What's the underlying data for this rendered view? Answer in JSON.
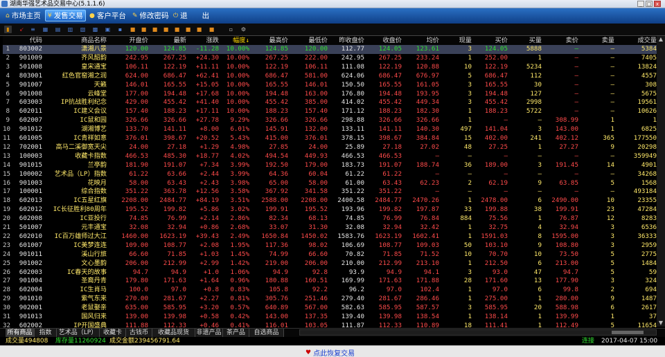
{
  "window": {
    "title": "湖南华强艺术品交易中心(5.1.1.6)"
  },
  "menu": [
    {
      "label": "市场主页",
      "icon": "house-icon",
      "active": false
    },
    {
      "label": "发售交易",
      "icon": "yen-icon",
      "active": true
    },
    {
      "label": "客户平台",
      "icon": "person-icon",
      "active": false
    },
    {
      "label": "修改密码",
      "icon": "key-icon",
      "active": false
    },
    {
      "label": "退　　出",
      "icon": "exit-icon",
      "active": false
    }
  ],
  "toolbar_icons": [
    "quote-board-icon",
    "k-line-icon",
    "list-icon",
    "table-icon",
    "calc-icon",
    "chart-icon",
    "chart2-icon",
    "grid-icon",
    "report-icon",
    "report2-icon",
    "print-icon",
    "doc-icon",
    "doc2-icon",
    "doc3-icon",
    "doc4-icon",
    "doc5-icon",
    "export-icon",
    "refresh-icon",
    "settings-icon",
    "gear-icon"
  ],
  "table": {
    "columns": [
      "",
      "代码",
      "商品名称",
      "开盘价",
      "最新",
      "涨跌",
      "幅度↓",
      "最高价",
      "最低价",
      "昨收盘价",
      "收盘价",
      "均价",
      "现量",
      "买价",
      "买量",
      "卖价",
      "卖量",
      "成交量"
    ],
    "rows": [
      [
        "1",
        "803002",
        "潇湘八景",
        "120.00",
        "124.85",
        "-11.28",
        "10.00%",
        "124.85",
        "120.00",
        "112.77",
        "124.05",
        "123.61",
        "3",
        "124.05",
        "5888",
        "—",
        "—",
        "5384"
      ],
      [
        "2",
        "901009",
        "齐风韶韵",
        "242.95",
        "267.25",
        "+24.30",
        "10.00%",
        "267.25",
        "222.00",
        "242.95",
        "267.25",
        "233.24",
        "1",
        "252.00",
        "1",
        "—",
        "—",
        "7405"
      ],
      [
        "3",
        "501008",
        "皇宋通宝",
        "106.11",
        "122.19",
        "+11.11",
        "10.00%",
        "122.19",
        "106.11",
        "111.08",
        "122.19",
        "120.88",
        "10",
        "122.19",
        "5234",
        "—",
        "—",
        "13824"
      ],
      [
        "4",
        "803001",
        "红色官窑湘之润",
        "624.00",
        "686.47",
        "+62.41",
        "10.00%",
        "686.47",
        "581.00",
        "624.06",
        "686.47",
        "676.97",
        "5",
        "686.47",
        "112",
        "—",
        "—",
        "4557"
      ],
      [
        "5",
        "901007",
        "天籁",
        "146.01",
        "165.55",
        "+15.05",
        "10.00%",
        "165.55",
        "146.01",
        "150.50",
        "165.55",
        "161.05",
        "3",
        "165.55",
        "30",
        "—",
        "—",
        "308"
      ],
      [
        "6",
        "901008",
        "云峰堂",
        "177.00",
        "194.48",
        "+17.68",
        "10.00%",
        "194.48",
        "163.00",
        "176.80",
        "194.48",
        "193.95",
        "3",
        "194.48",
        "127",
        "—",
        "—",
        "5675"
      ],
      [
        "7",
        "603003",
        "IP抗战胜利纪念",
        "429.00",
        "455.42",
        "+41.40",
        "10.00%",
        "455.42",
        "385.00",
        "414.02",
        "455.42",
        "449.34",
        "3",
        "455.42",
        "2998",
        "—",
        "—",
        "19561"
      ],
      [
        "8",
        "602011",
        "IC建义会议",
        "157.40",
        "188.23",
        "+17.11",
        "10.00%",
        "188.23",
        "157.40",
        "171.12",
        "188.23",
        "182.30",
        "1",
        "188.23",
        "5722",
        "—",
        "—",
        "10626"
      ],
      [
        "9",
        "602007",
        "IC鼠和园",
        "326.66",
        "326.66",
        "+27.78",
        "9.29%",
        "326.66",
        "326.66",
        "298.88",
        "326.66",
        "326.66",
        "1",
        "—",
        "—",
        "308.99",
        "1",
        "1"
      ],
      [
        "10",
        "901012",
        "湖湘博艺",
        "133.70",
        "141.11",
        "+8.00",
        "6.01%",
        "145.91",
        "132.00",
        "133.11",
        "141.11",
        "140.30",
        "497",
        "141.04",
        "3",
        "143.00",
        "1",
        "6825"
      ],
      [
        "11",
        "601005",
        "IC青祥如意",
        "376.01",
        "398.67",
        "+20.52",
        "5.43%",
        "415.00",
        "376.01",
        "378.15",
        "398.67",
        "384.84",
        "15",
        "402.00",
        "241",
        "402.12",
        "365",
        "177550"
      ],
      [
        "12",
        "702001",
        "高马二溪御宽天尖",
        "24.00",
        "27.18",
        "+1.29",
        "4.98%",
        "27.85",
        "24.00",
        "25.89",
        "27.18",
        "27.02",
        "48",
        "27.25",
        "1",
        "27.27",
        "9",
        "20298"
      ],
      [
        "13",
        "100003",
        "收藏卡指数",
        "466.53",
        "485.30",
        "+18.77",
        "4.02%",
        "494.54",
        "449.93",
        "466.53",
        "466.53",
        "—",
        "—",
        "—",
        "—",
        "—",
        "—",
        "359949"
      ],
      [
        "14",
        "901015",
        "兰亭韵",
        "181.90",
        "191.07",
        "+7.34",
        "3.99%",
        "192.50",
        "179.00",
        "183.73",
        "191.07",
        "188.74",
        "36",
        "189.00",
        "3",
        "191.45",
        "14",
        "4901"
      ],
      [
        "15",
        "100002",
        "艺术品（LP）指数",
        "61.22",
        "63.66",
        "+2.44",
        "3.99%",
        "64.36",
        "60.04",
        "61.22",
        "61.22",
        "—",
        "—",
        "—",
        "—",
        "—",
        "—",
        "34268"
      ],
      [
        "16",
        "901003",
        "花映月",
        "58.00",
        "63.43",
        "+2.43",
        "3.98%",
        "65.00",
        "58.00",
        "61.00",
        "63.43",
        "62.23",
        "2",
        "62.19",
        "9",
        "63.85",
        "5",
        "1568"
      ],
      [
        "17",
        "100001",
        "综合指数",
        "351.22",
        "363.78",
        "+12.56",
        "3.58%",
        "367.92",
        "341.58",
        "351.22",
        "351.22",
        "—",
        "—",
        "—",
        "—",
        "—",
        "—",
        "493184"
      ],
      [
        "18",
        "602013",
        "IC五星红旗",
        "2208.00",
        "2484.77",
        "+84.19",
        "3.51%",
        "2588.00",
        "2208.00",
        "2400.58",
        "2484.77",
        "2470.26",
        "1",
        "2478.00",
        "6",
        "2490.00",
        "10",
        "23355"
      ],
      [
        "19",
        "602012",
        "IC长征胜利80周年",
        "195.52",
        "199.82",
        "+5.86",
        "3.02%",
        "199.91",
        "195.52",
        "193.96",
        "199.82",
        "197.87",
        "33",
        "199.88",
        "38",
        "199.91",
        "23",
        "47284"
      ],
      [
        "20",
        "602008",
        "IC亚投行",
        "74.85",
        "76.99",
        "+2.14",
        "2.86%",
        "82.34",
        "68.13",
        "74.85",
        "76.99",
        "76.84",
        "884",
        "75.56",
        "1",
        "76.87",
        "12",
        "8283"
      ],
      [
        "21",
        "501007",
        "元丰通宝",
        "32.08",
        "32.94",
        "+0.86",
        "2.68%",
        "33.07",
        "31.30",
        "32.08",
        "32.94",
        "32.42",
        "1",
        "32.75",
        "4",
        "32.94",
        "3",
        "6536"
      ],
      [
        "22",
        "602010",
        "IC百万雄师过大江",
        "1460.00",
        "1623.19",
        "+39.43",
        "2.49%",
        "1650.84",
        "1450.02",
        "1583.76",
        "1623.19",
        "1602.41",
        "1",
        "1591.03",
        "8",
        "1595.00",
        "3",
        "36333"
      ],
      [
        "23",
        "601007",
        "IC美梦连连",
        "109.00",
        "108.77",
        "+2.08",
        "1.95%",
        "117.36",
        "98.02",
        "106.69",
        "108.77",
        "109.03",
        "50",
        "103.10",
        "9",
        "108.80",
        "3",
        "2959"
      ],
      [
        "24",
        "901011",
        "溪山行旅",
        "66.60",
        "71.85",
        "+1.03",
        "1.45%",
        "74.99",
        "66.60",
        "70.82",
        "71.85",
        "71.52",
        "10",
        "70.70",
        "10",
        "73.50",
        "5",
        "2775"
      ],
      [
        "25",
        "901002",
        "文心墨韵",
        "206.00",
        "212.99",
        "+2.99",
        "1.42%",
        "219.00",
        "206.00",
        "210.00",
        "212.99",
        "213.10",
        "1",
        "212.50",
        "6",
        "213.00",
        "5",
        "1484"
      ],
      [
        "26",
        "602003",
        "IC春天的故事",
        "94.7",
        "94.9",
        "+1.0",
        "1.06%",
        "94.9",
        "92.8",
        "93.9",
        "94.9",
        "94.1",
        "3",
        "93.0",
        "47",
        "94.7",
        "5",
        "59"
      ],
      [
        "27",
        "901004",
        "圣裔丹青",
        "179.80",
        "171.63",
        "+1.64",
        "0.96%",
        "180.88",
        "160.51",
        "169.99",
        "171.63",
        "171.88",
        "28",
        "171.60",
        "13",
        "177.90",
        "3",
        "324"
      ],
      [
        "28",
        "602004",
        "IC生肖马",
        "100.0",
        "97.0",
        "+0.8",
        "0.83%",
        "105.8",
        "92.2",
        "96.2",
        "97.0",
        "102.4",
        "1",
        "97.0",
        "6",
        "99.8",
        "2",
        "694"
      ],
      [
        "29",
        "901010",
        "紫气东来",
        "270.00",
        "281.67",
        "+2.27",
        "0.81%",
        "305.76",
        "251.46",
        "279.40",
        "281.67",
        "286.46",
        "1",
        "275.00",
        "1",
        "280.00",
        "9",
        "1487"
      ],
      [
        "30",
        "902001",
        "老鼠娶亲",
        "635.00",
        "585.95",
        "+3.20",
        "0.57%",
        "640.89",
        "567.00",
        "582.63",
        "585.95",
        "587.57",
        "3",
        "585.95",
        "20",
        "588.98",
        "6",
        "2617"
      ],
      [
        "31",
        "901013",
        "国风归来",
        "139.00",
        "139.98",
        "+0.58",
        "0.42%",
        "143.00",
        "137.35",
        "139.40",
        "139.98",
        "138.54",
        "1",
        "138.14",
        "1",
        "139.99",
        "1",
        "37"
      ],
      [
        "32",
        "602002",
        "IP开国盛典",
        "111.88",
        "112.33",
        "+0.46",
        "0.41%",
        "116.01",
        "103.05",
        "111.87",
        "112.33",
        "110.89",
        "18",
        "111.41",
        "1",
        "112.49",
        "5",
        "11654"
      ]
    ]
  },
  "tabs": [
    {
      "label": "所有商品",
      "active": true
    },
    {
      "label": "指数",
      "active": false
    },
    {
      "label": "艺术品（LP）",
      "active": false
    },
    {
      "label": "收藏卡",
      "active": false
    },
    {
      "label": "古钱币",
      "active": false
    },
    {
      "label": "收藏品现货",
      "active": false
    },
    {
      "label": "非遗产品",
      "active": false
    },
    {
      "label": "茶产品",
      "active": false
    },
    {
      "label": "自选商品",
      "active": false
    }
  ],
  "status": {
    "volume_label": "成交量494808",
    "stock_label": "库存量11260924",
    "amount_label": "成交金额239456791.64",
    "connection": "连接",
    "datetime": "2017-04-07 15:00"
  },
  "bottom": {
    "restore_label": "点此恢复交易"
  }
}
